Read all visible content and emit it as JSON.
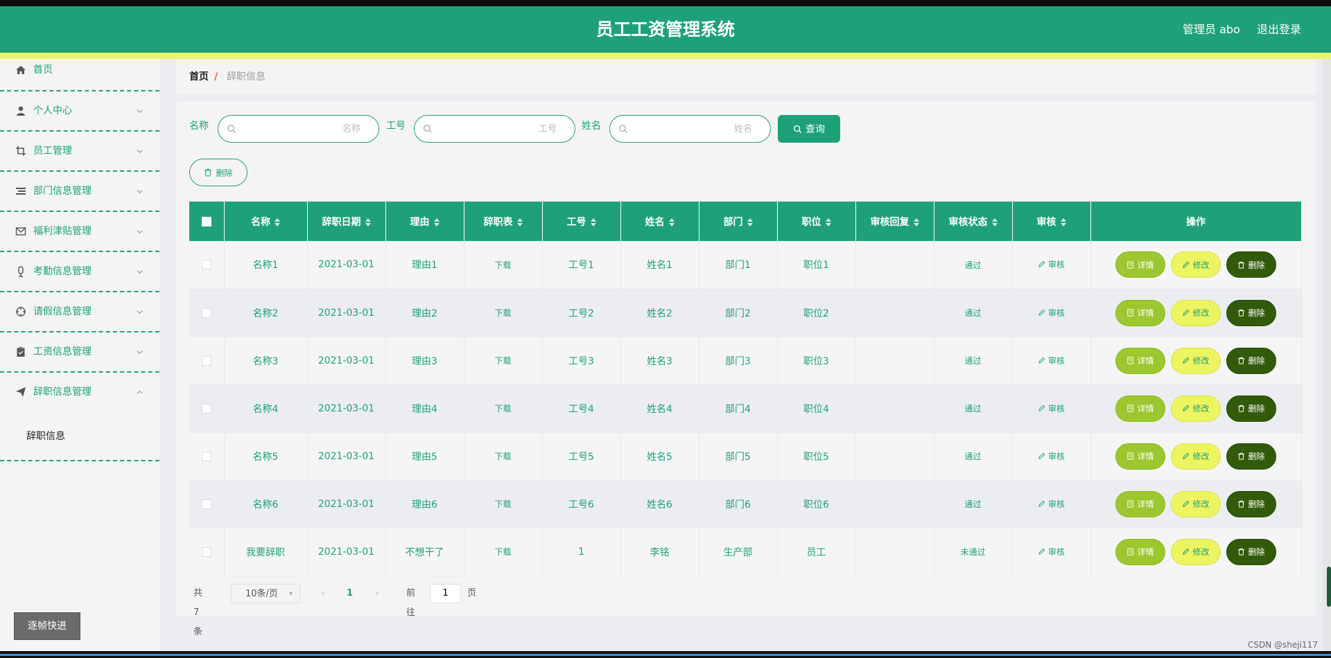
{
  "header": {
    "title": "员工工资管理系统",
    "user": "管理员 abo",
    "logout": "退出登录"
  },
  "sidebar": {
    "items": [
      {
        "label": "首页",
        "icon": "home-icon"
      },
      {
        "label": "个人中心",
        "icon": "user-icon"
      },
      {
        "label": "员工管理",
        "icon": "crop-icon"
      },
      {
        "label": "部门信息管理",
        "icon": "list-icon"
      },
      {
        "label": "福利津贴管理",
        "icon": "mail-icon"
      },
      {
        "label": "考勤信息管理",
        "icon": "mic-icon"
      },
      {
        "label": "请假信息管理",
        "icon": "target-icon"
      },
      {
        "label": "工资信息管理",
        "icon": "clipboard-icon"
      },
      {
        "label": "辞职信息管理",
        "icon": "paper-plane-icon"
      }
    ],
    "submenu": {
      "label": "辞职信息"
    },
    "frame_button": "逐帧快进"
  },
  "breadcrumb": {
    "home": "首页",
    "separator": "/",
    "current": "辞职信息"
  },
  "search": {
    "name_label": "名称",
    "name_placeholder": "名称",
    "id_label": "工号",
    "id_placeholder": "工号",
    "person_label": "姓名",
    "person_placeholder": "姓名",
    "query_button": "查询"
  },
  "toolbar": {
    "delete_button": "删除"
  },
  "table": {
    "headers": [
      "名称",
      "辞职日期",
      "理由",
      "辞职表",
      "工号",
      "姓名",
      "部门",
      "职位",
      "审核回复",
      "审核状态",
      "审核",
      "操作"
    ],
    "rows": [
      {
        "name": "名称1",
        "date": "2021-03-01",
        "reason": "理由1",
        "form": "下载",
        "id": "工号1",
        "person": "姓名1",
        "dept": "部门1",
        "position": "职位1",
        "reply": "",
        "status": "通过",
        "review": "审核"
      },
      {
        "name": "名称2",
        "date": "2021-03-01",
        "reason": "理由2",
        "form": "下载",
        "id": "工号2",
        "person": "姓名2",
        "dept": "部门2",
        "position": "职位2",
        "reply": "",
        "status": "通过",
        "review": "审核"
      },
      {
        "name": "名称3",
        "date": "2021-03-01",
        "reason": "理由3",
        "form": "下载",
        "id": "工号3",
        "person": "姓名3",
        "dept": "部门3",
        "position": "职位3",
        "reply": "",
        "status": "通过",
        "review": "审核"
      },
      {
        "name": "名称4",
        "date": "2021-03-01",
        "reason": "理由4",
        "form": "下载",
        "id": "工号4",
        "person": "姓名4",
        "dept": "部门4",
        "position": "职位4",
        "reply": "",
        "status": "通过",
        "review": "审核"
      },
      {
        "name": "名称5",
        "date": "2021-03-01",
        "reason": "理由5",
        "form": "下载",
        "id": "工号5",
        "person": "姓名5",
        "dept": "部门5",
        "position": "职位5",
        "reply": "",
        "status": "通过",
        "review": "审核"
      },
      {
        "name": "名称6",
        "date": "2021-03-01",
        "reason": "理由6",
        "form": "下载",
        "id": "工号6",
        "person": "姓名6",
        "dept": "部门6",
        "position": "职位6",
        "reply": "",
        "status": "通过",
        "review": "审核"
      },
      {
        "name": "我要辞职",
        "date": "2021-03-01",
        "reason": "不想干了",
        "form": "下载",
        "id": "1",
        "person": "李铭",
        "dept": "生产部",
        "position": "员工",
        "reply": "",
        "status": "未通过",
        "review": "审核"
      }
    ],
    "actions": {
      "detail": "详情",
      "edit": "修改",
      "remove": "删除"
    }
  },
  "pagination": {
    "total": "共 7 条",
    "page_size": "10条/页",
    "current_page": "1",
    "goto_prefix": "前往",
    "goto_value": "1",
    "goto_suffix": "页"
  },
  "watermark": "CSDN @sheji117",
  "colors": {
    "primary": "#1ea178",
    "accent_yellow": "#e9f56a",
    "detail_green": "#9dc72e",
    "edit_yellow": "#ecf460",
    "remove_dark": "#325a0b"
  }
}
